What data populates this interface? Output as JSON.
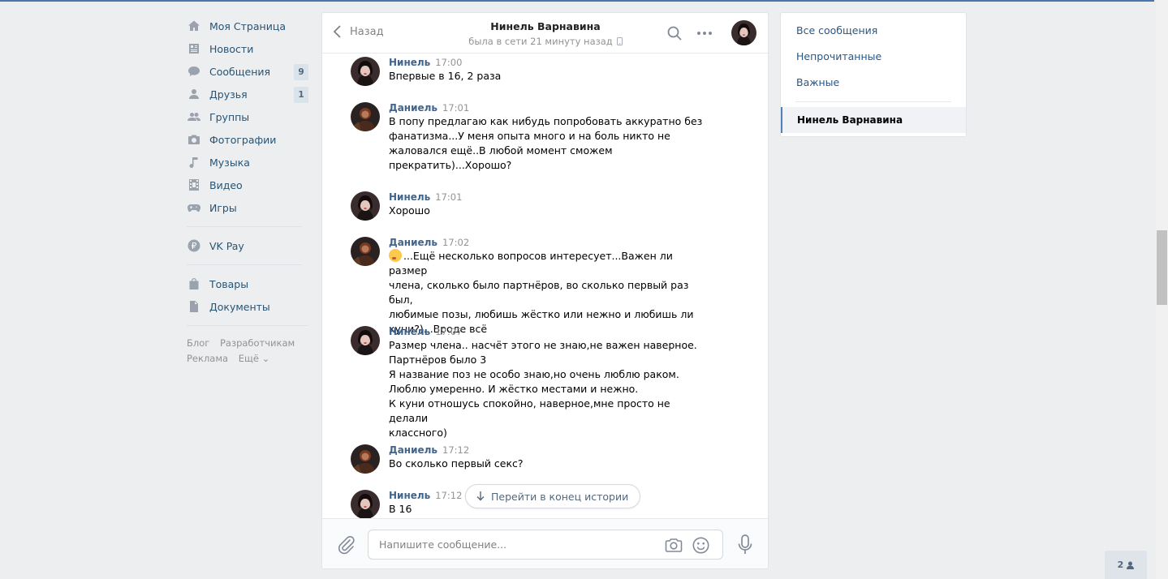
{
  "nav": {
    "items": [
      {
        "label": "Моя Страница",
        "icon": "home-icon",
        "count": ""
      },
      {
        "label": "Новости",
        "icon": "news-icon",
        "count": ""
      },
      {
        "label": "Сообщения",
        "icon": "messages-icon",
        "count": "9"
      },
      {
        "label": "Друзья",
        "icon": "friends-icon",
        "count": "1"
      },
      {
        "label": "Группы",
        "icon": "groups-icon",
        "count": ""
      },
      {
        "label": "Фотографии",
        "icon": "camera-icon",
        "count": ""
      },
      {
        "label": "Музыка",
        "icon": "music-icon",
        "count": ""
      },
      {
        "label": "Видео",
        "icon": "video-icon",
        "count": ""
      },
      {
        "label": "Игры",
        "icon": "gamepad-icon",
        "count": ""
      }
    ],
    "pay": {
      "label": "VK Pay",
      "icon": "ruble-icon"
    },
    "extra": [
      {
        "label": "Товары",
        "icon": "bag-icon"
      },
      {
        "label": "Документы",
        "icon": "document-icon"
      }
    ],
    "footer": {
      "blog": "Блог",
      "dev": "Разработчикам",
      "ads": "Реклама",
      "more": "Ещё ⌄"
    }
  },
  "chat": {
    "back_label": "Назад",
    "name": "Нинель Варнавина",
    "status": "была в сети 21 минуту назад",
    "messages": [
      {
        "author": "Нинель",
        "time": "17:00",
        "text": "Впервые в 16, 2 раза",
        "who": "ninel"
      },
      {
        "author": "Даниель",
        "time": "17:01",
        "text": "В попу предлагаю как нибудь попробовать аккуратно без\nфанатизма...У меня опыта много и на боль никто не\nжаловался ещё..В любой момент сможем\nпрекратить)...Хорошо?",
        "who": "daniel"
      },
      {
        "author": "Нинель",
        "time": "17:01",
        "text": "Хорошо",
        "who": "ninel"
      },
      {
        "author": "Даниель",
        "time": "17:02",
        "text": "...Ещё несколько вопросов интересует...Важен ли размер\nчлена, сколько было партнёров, во сколько первый раз был,\nлюбимые позы, любишь жёстко или нежно и любишь ли\nкуни?)...Вроде всё",
        "who": "daniel",
        "emoji": "kissing-emoji"
      },
      {
        "author": "Нинель",
        "time": "17:07",
        "text": "Размер члена.. насчёт этого не знаю,не важен наверное.\nПартнёров было 3\nЯ название поз не особо знаю,но очень люблю раком.\nЛюблю умеренно. И жёстко местами и нежно.\nК куни отношусь спокойно, наверное,мне просто не делали\nклассного)",
        "who": "ninel"
      },
      {
        "author": "Даниель",
        "time": "17:12",
        "text": "Во сколько первый секс?",
        "who": "daniel"
      },
      {
        "author": "Нинель",
        "time": "17:12",
        "text": "В 16",
        "who": "ninel"
      }
    ],
    "jump_label": "Перейти в конец истории",
    "input_placeholder": "Напишите сообщение..."
  },
  "right": {
    "items": [
      "Все сообщения",
      "Непрочитанные",
      "Важные"
    ],
    "active": "Нинель Варнавина"
  },
  "online_count": "2",
  "colors": {
    "background": "#edeef0",
    "link": "#2a5885",
    "author": "#42648b",
    "accent": "#5181b8",
    "badge": "#dae2ea"
  }
}
